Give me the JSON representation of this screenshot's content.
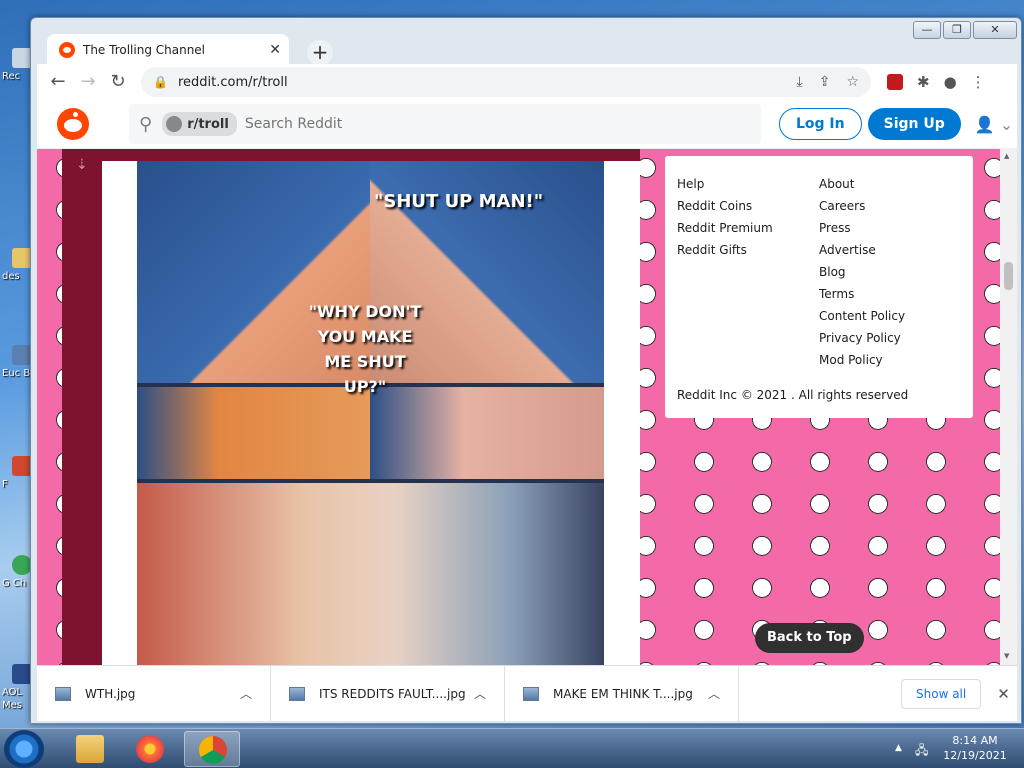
{
  "desktop": {
    "icons": [
      {
        "label": "Rec",
        "icon": "recycle-bin-icon"
      },
      {
        "label": "des",
        "icon": "shortcut-icon"
      },
      {
        "label": "Euc B",
        "icon": "app-shortcut-icon"
      },
      {
        "label": "F",
        "icon": "app-shortcut-icon"
      },
      {
        "label": "G Ch",
        "icon": "chrome-shortcut-icon"
      },
      {
        "label": "AOL Mes",
        "icon": "aol-shortcut-icon"
      }
    ]
  },
  "browser": {
    "tab": {
      "title": "The Trolling Channel",
      "close": "✕",
      "favicon": "reddit-favicon"
    },
    "new_tab": "+",
    "nav": {
      "back": "←",
      "forward": "→",
      "reload": "↻"
    },
    "address": {
      "url": "reddit.com/r/troll",
      "lock": "🔒"
    },
    "window_controls": {
      "minimize": "—",
      "maximize": "❐",
      "close": "✕"
    }
  },
  "reddit": {
    "search": {
      "subreddit": "r/troll",
      "placeholder": "Search Reddit"
    },
    "login_label": "Log In",
    "signup_label": "Sign Up",
    "post": {
      "caption_top": "\"SHUT UP MAN!\"",
      "caption_middle": "\"WHY DON'T YOU MAKE ME SHUT UP?\""
    },
    "footer": {
      "col1": [
        "Help",
        "Reddit Coins",
        "Reddit Premium",
        "Reddit Gifts"
      ],
      "col2": [
        "About",
        "Careers",
        "Press",
        "Advertise",
        "Blog",
        "Terms",
        "Content Policy",
        "Privacy Policy",
        "Mod Policy"
      ],
      "copyright": "Reddit Inc © 2021 . All rights reserved"
    },
    "back_to_top": "Back to Top",
    "colors": {
      "brand": "#ff4500",
      "primary_blue": "#0079d3",
      "page_bg": "#f46aa8"
    }
  },
  "downloads": {
    "items": [
      {
        "name": "WTH.jpg"
      },
      {
        "name": "ITS REDDITS FAULT....jpg"
      },
      {
        "name": "MAKE EM THINK T....jpg"
      }
    ],
    "show_all": "Show all",
    "close": "✕"
  },
  "taskbar": {
    "clock_time": "8:14 AM",
    "clock_date": "12/19/2021",
    "apps": [
      "file-explorer-icon",
      "firefox-icon",
      "chrome-icon"
    ]
  }
}
